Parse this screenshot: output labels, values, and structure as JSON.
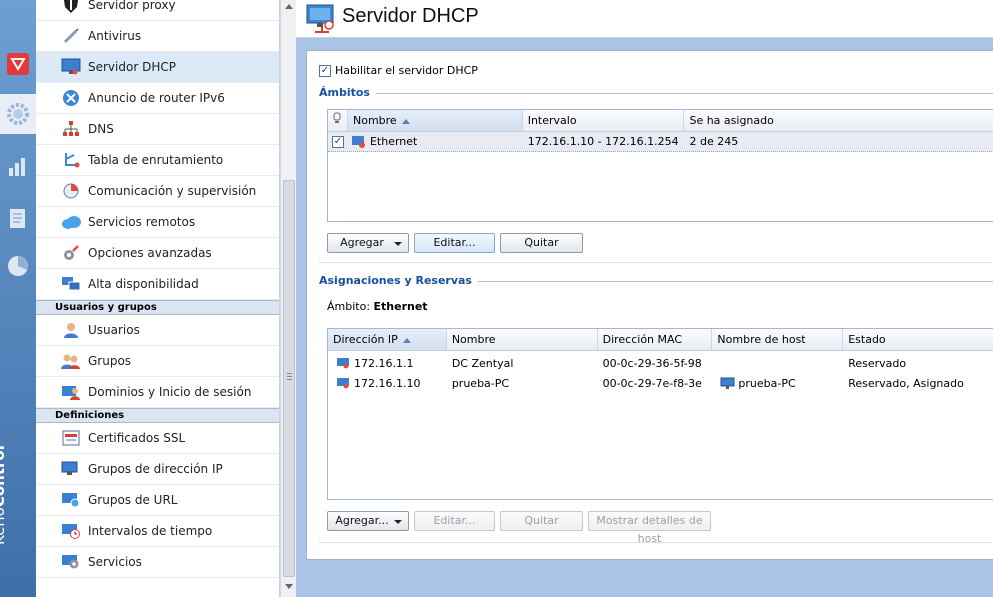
{
  "brand": {
    "prefix": "Kerio",
    "suffix": "Control"
  },
  "page": {
    "title": "Servidor DHCP"
  },
  "nav": {
    "items_top": [
      {
        "label": "Servidor proxy",
        "icon": "shield-icon"
      },
      {
        "label": "Antivirus",
        "icon": "syringe-icon"
      },
      {
        "label": "Servidor DHCP",
        "icon": "monitor-icon",
        "selected": true
      },
      {
        "label": "Anuncio de router IPv6",
        "icon": "router-icon"
      },
      {
        "label": "DNS",
        "icon": "network-tree-icon"
      },
      {
        "label": "Tabla de enrutamiento",
        "icon": "routing-icon"
      },
      {
        "label": "Comunicación y supervisión",
        "icon": "pie-icon"
      },
      {
        "label": "Servicios remotos",
        "icon": "cloud-icon"
      },
      {
        "label": "Opciones avanzadas",
        "icon": "tools-icon"
      },
      {
        "label": "Alta disponibilidad",
        "icon": "servers-icon"
      }
    ],
    "section_users": "Usuarios y grupos",
    "items_users": [
      {
        "label": "Usuarios",
        "icon": "user-icon"
      },
      {
        "label": "Grupos",
        "icon": "group-icon"
      },
      {
        "label": "Dominios y Inicio de sesión",
        "icon": "domain-icon"
      }
    ],
    "section_defs": "Definiciones",
    "items_defs": [
      {
        "label": "Certificados SSL",
        "icon": "certificate-icon"
      },
      {
        "label": "Grupos de dirección IP",
        "icon": "ip-group-icon"
      },
      {
        "label": "Grupos de URL",
        "icon": "url-group-icon"
      },
      {
        "label": "Intervalos de tiempo",
        "icon": "clock-icon"
      },
      {
        "label": "Servicios",
        "icon": "services-icon"
      }
    ]
  },
  "dhcp": {
    "enable_label": "Habilitar el servidor DHCP",
    "enabled": true,
    "scopes": {
      "legend": "Ámbitos",
      "columns": [
        "Nombre",
        "Intervalo",
        "Se ha asignado"
      ],
      "rows": [
        {
          "checked": true,
          "name": "Ethernet",
          "range": "172.16.1.10 - 172.16.1.254",
          "assigned": "2 de 245"
        }
      ],
      "buttons": {
        "add": "Agregar",
        "edit": "Editar...",
        "remove": "Quitar"
      }
    },
    "reservations": {
      "legend": "Asignaciones y Reservas",
      "scope_label": "Ámbito:",
      "scope_value": "Ethernet",
      "columns": [
        "Dirección IP",
        "Nombre",
        "Dirección MAC",
        "Nombre de host",
        "Estado"
      ],
      "rows": [
        {
          "ip": "172.16.1.1",
          "name": "DC Zentyal",
          "mac": "00-0c-29-36-5f-98",
          "host": "",
          "status": "Reservado"
        },
        {
          "ip": "172.16.1.10",
          "name": "prueba-PC",
          "mac": "00-0c-29-7e-f8-3e",
          "host": "prueba-PC",
          "status": "Reservado, Asignado"
        }
      ],
      "buttons": {
        "add": "Agregar...",
        "edit": "Editar...",
        "remove": "Quitar",
        "details": "Mostrar detalles de host"
      }
    }
  },
  "colors": {
    "accent": "#1a4f9c",
    "rail": "#3f6fa8",
    "main_bg": "#a9c4e7",
    "selection": "#dce9f7"
  }
}
